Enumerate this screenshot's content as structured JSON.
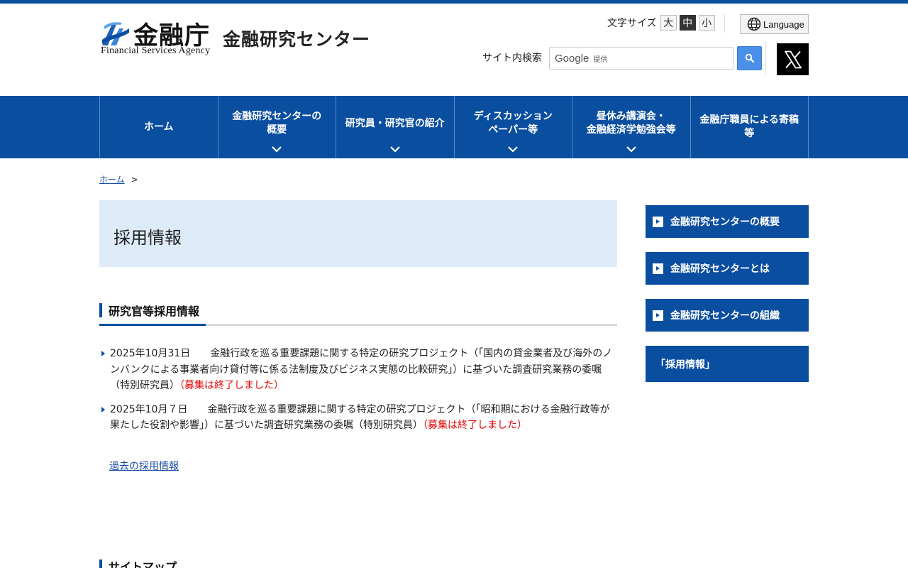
{
  "colors": {
    "brand": "#0a4ea0",
    "title_bg": "#dcebf7",
    "closed_notice": "#e60000",
    "link": "#1a4fa3"
  },
  "header": {
    "logo_agency": "金融庁",
    "logo_agency_en": "Financial Services Agency",
    "logo_center": "金融研究センター",
    "font_size_label": "文字サイズ",
    "font_sizes": [
      "大",
      "中",
      "小"
    ],
    "font_size_selected": "中",
    "language_label": "Language",
    "search_label": "サイト内検索",
    "search_brand": "Google",
    "search_brand_sub": "提供",
    "search_icon": "search-icon",
    "social_icon": "x-logo-icon"
  },
  "nav": {
    "items": [
      {
        "label": "ホーム"
      },
      {
        "label": "金融研究センターの\n概要"
      },
      {
        "label": "研究員・研究官の紹介"
      },
      {
        "label": "ディスカッション\nペーパー等"
      },
      {
        "label": "昼休み講演会・\n金融経済学勉強会等"
      },
      {
        "label": "金融庁職員による寄稿\n等"
      }
    ]
  },
  "breadcrumb": {
    "home": "ホーム",
    "separator": ">"
  },
  "main": {
    "page_title": "採用情報",
    "section_heading": "研究官等採用情報",
    "news": [
      {
        "date": "2025年10月31日",
        "text": "金融行政を巡る重要課題に関する特定の研究プロジェクト（「国内の貸金業者及び海外のノンバンクによる事業者向け貸付等に係る法制度及びビジネス実態の比較研究」）に基づいた調査研究業務の委嘱（特別研究員）",
        "status": "（募集は終了しました）"
      },
      {
        "date": "2025年10月７日",
        "text": "金融行政を巡る重要課題に関する特定の研究プロジェクト（「昭和期における金融行政等が果たした役割や影響」）に基づいた調査研究業務の委嘱（特別研究員）",
        "status": "（募集は終了しました）"
      }
    ],
    "past_link": "過去の採用情報",
    "sitemap_heading": "サイトマップ"
  },
  "side_menu": {
    "items": [
      {
        "label": "金融研究センターの概要"
      },
      {
        "label": "金融研究センターとは"
      },
      {
        "label": "金融研究センターの組織"
      }
    ],
    "current": "「採用情報」"
  }
}
